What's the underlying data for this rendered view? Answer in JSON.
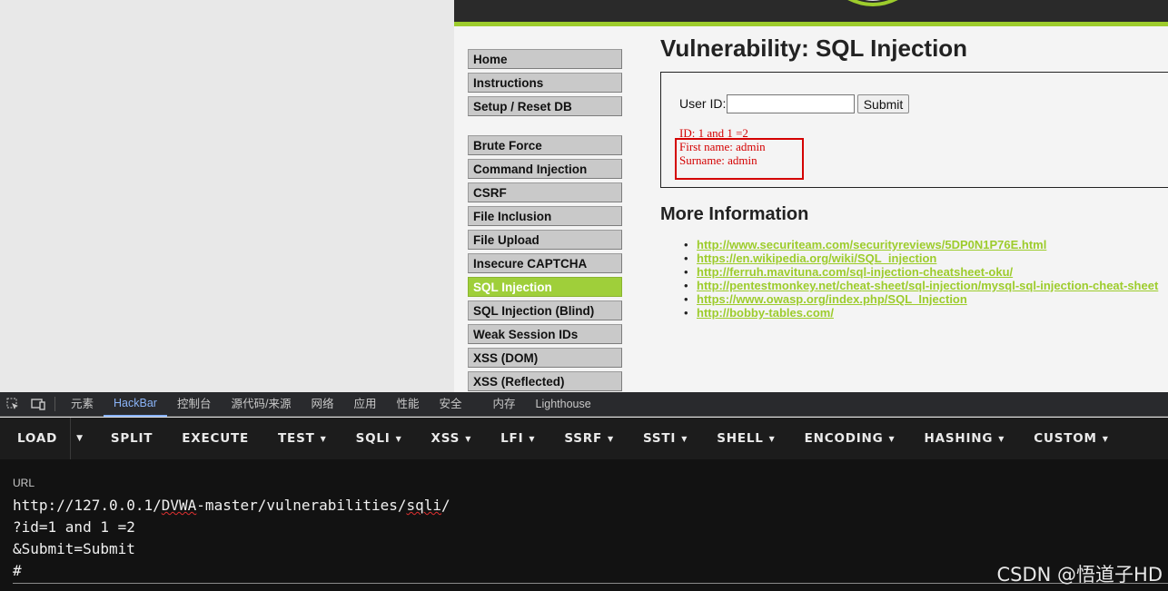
{
  "menu": {
    "group1": [
      "Home",
      "Instructions",
      "Setup / Reset DB"
    ],
    "group2": [
      "Brute Force",
      "Command Injection",
      "CSRF",
      "File Inclusion",
      "File Upload",
      "Insecure CAPTCHA",
      "SQL Injection",
      "SQL Injection (Blind)",
      "Weak Session IDs",
      "XSS (DOM)",
      "XSS (Reflected)"
    ],
    "active": "SQL Injection"
  },
  "main": {
    "title": "Vulnerability: SQL Injection",
    "form": {
      "user_id_label": "User ID:",
      "user_id_value": "",
      "submit_label": "Submit"
    },
    "result": {
      "id_line": "ID: 1 and 1 =2",
      "first_name_line": "First name: admin",
      "surname_line": "Surname: admin"
    },
    "more_info_title": "More Information",
    "links": [
      "http://www.securiteam.com/securityreviews/5DP0N1P76E.html",
      "https://en.wikipedia.org/wiki/SQL_injection",
      "http://ferruh.mavituna.com/sql-injection-cheatsheet-oku/",
      "http://pentestmonkey.net/cheat-sheet/sql-injection/mysql-sql-injection-cheat-sheet",
      "https://www.owasp.org/index.php/SQL_Injection",
      "http://bobby-tables.com/"
    ],
    "link_color": "#9dcc2c",
    "result_color": "#d40000"
  },
  "devtools": {
    "tabs": [
      "元素",
      "HackBar",
      "控制台",
      "源代码/来源",
      "网络",
      "应用",
      "性能",
      "安全",
      "内存",
      "Lighthouse"
    ],
    "active_tab": "HackBar",
    "icons": [
      "inspect-icon",
      "device-toolbar-icon"
    ]
  },
  "hackbar": {
    "load": "LOAD",
    "buttons": [
      {
        "label": "SPLIT",
        "dropdown": false
      },
      {
        "label": "EXECUTE",
        "dropdown": false
      },
      {
        "label": "TEST",
        "dropdown": true
      },
      {
        "label": "SQLI",
        "dropdown": true
      },
      {
        "label": "XSS",
        "dropdown": true
      },
      {
        "label": "LFI",
        "dropdown": true
      },
      {
        "label": "SSRF",
        "dropdown": true
      },
      {
        "label": "SSTI",
        "dropdown": true
      },
      {
        "label": "SHELL",
        "dropdown": true
      },
      {
        "label": "ENCODING",
        "dropdown": true
      },
      {
        "label": "HASHING",
        "dropdown": true
      },
      {
        "label": "CUSTOM",
        "dropdown": true
      }
    ],
    "url_label": "URL",
    "url_lines": {
      "line1_prefix": "http://127.0.0.1/",
      "line1_squiggle1": "DVWA",
      "line1_mid": "-master/vulnerabilities/",
      "line1_squiggle2": "sqli",
      "line1_suffix": "/",
      "line2": "?id=1 and 1 =2",
      "line3": "&Submit=Submit",
      "line4": "#"
    },
    "watermark": "CSDN @悟道子HD"
  }
}
